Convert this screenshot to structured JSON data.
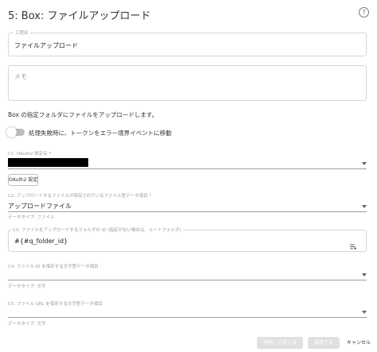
{
  "header": {
    "title": "5: Box: ファイルアップロード",
    "help_icon": "?"
  },
  "step_name": {
    "label": "工程名",
    "value": "ファイルアップロード"
  },
  "memo": {
    "placeholder": "メモ"
  },
  "description": "Box の指定フォルダにファイルをアップロードします。",
  "error_toggle": {
    "label": "処理失敗時に、トークンをエラー境界イベントに移動",
    "on": false
  },
  "c1": {
    "label": "C1: OAuth2 設定名 *",
    "value": ""
  },
  "oauth_button": {
    "label": "OAuth2 設定"
  },
  "c2": {
    "label": "C2: アップロードするファイルが保存されているファイル型データ項目 *",
    "value": "アップロードファイル",
    "helper": "データタイプ: ファイル"
  },
  "c3": {
    "label": "C3: ファイルをアップロードするフォルダの ID (指定がない場合は、ルートフォルダ)",
    "value": "#{#q_folder_id}"
  },
  "c4": {
    "label": "C4: ファイル ID を保存する文字型データ項目",
    "value": "",
    "helper": "データタイプ: 文字"
  },
  "c5": {
    "label": "C5: ファイル URL を保存する文字型データ項目",
    "value": "",
    "helper": "データタイプ: 文字"
  },
  "footer": {
    "apply_close": "適用して閉じる",
    "apply": "適用する",
    "cancel": "キャンセル"
  },
  "colors": {
    "accent": "#1976d2",
    "disabled_button": "#e0e0e0",
    "redaction": "#000000"
  }
}
